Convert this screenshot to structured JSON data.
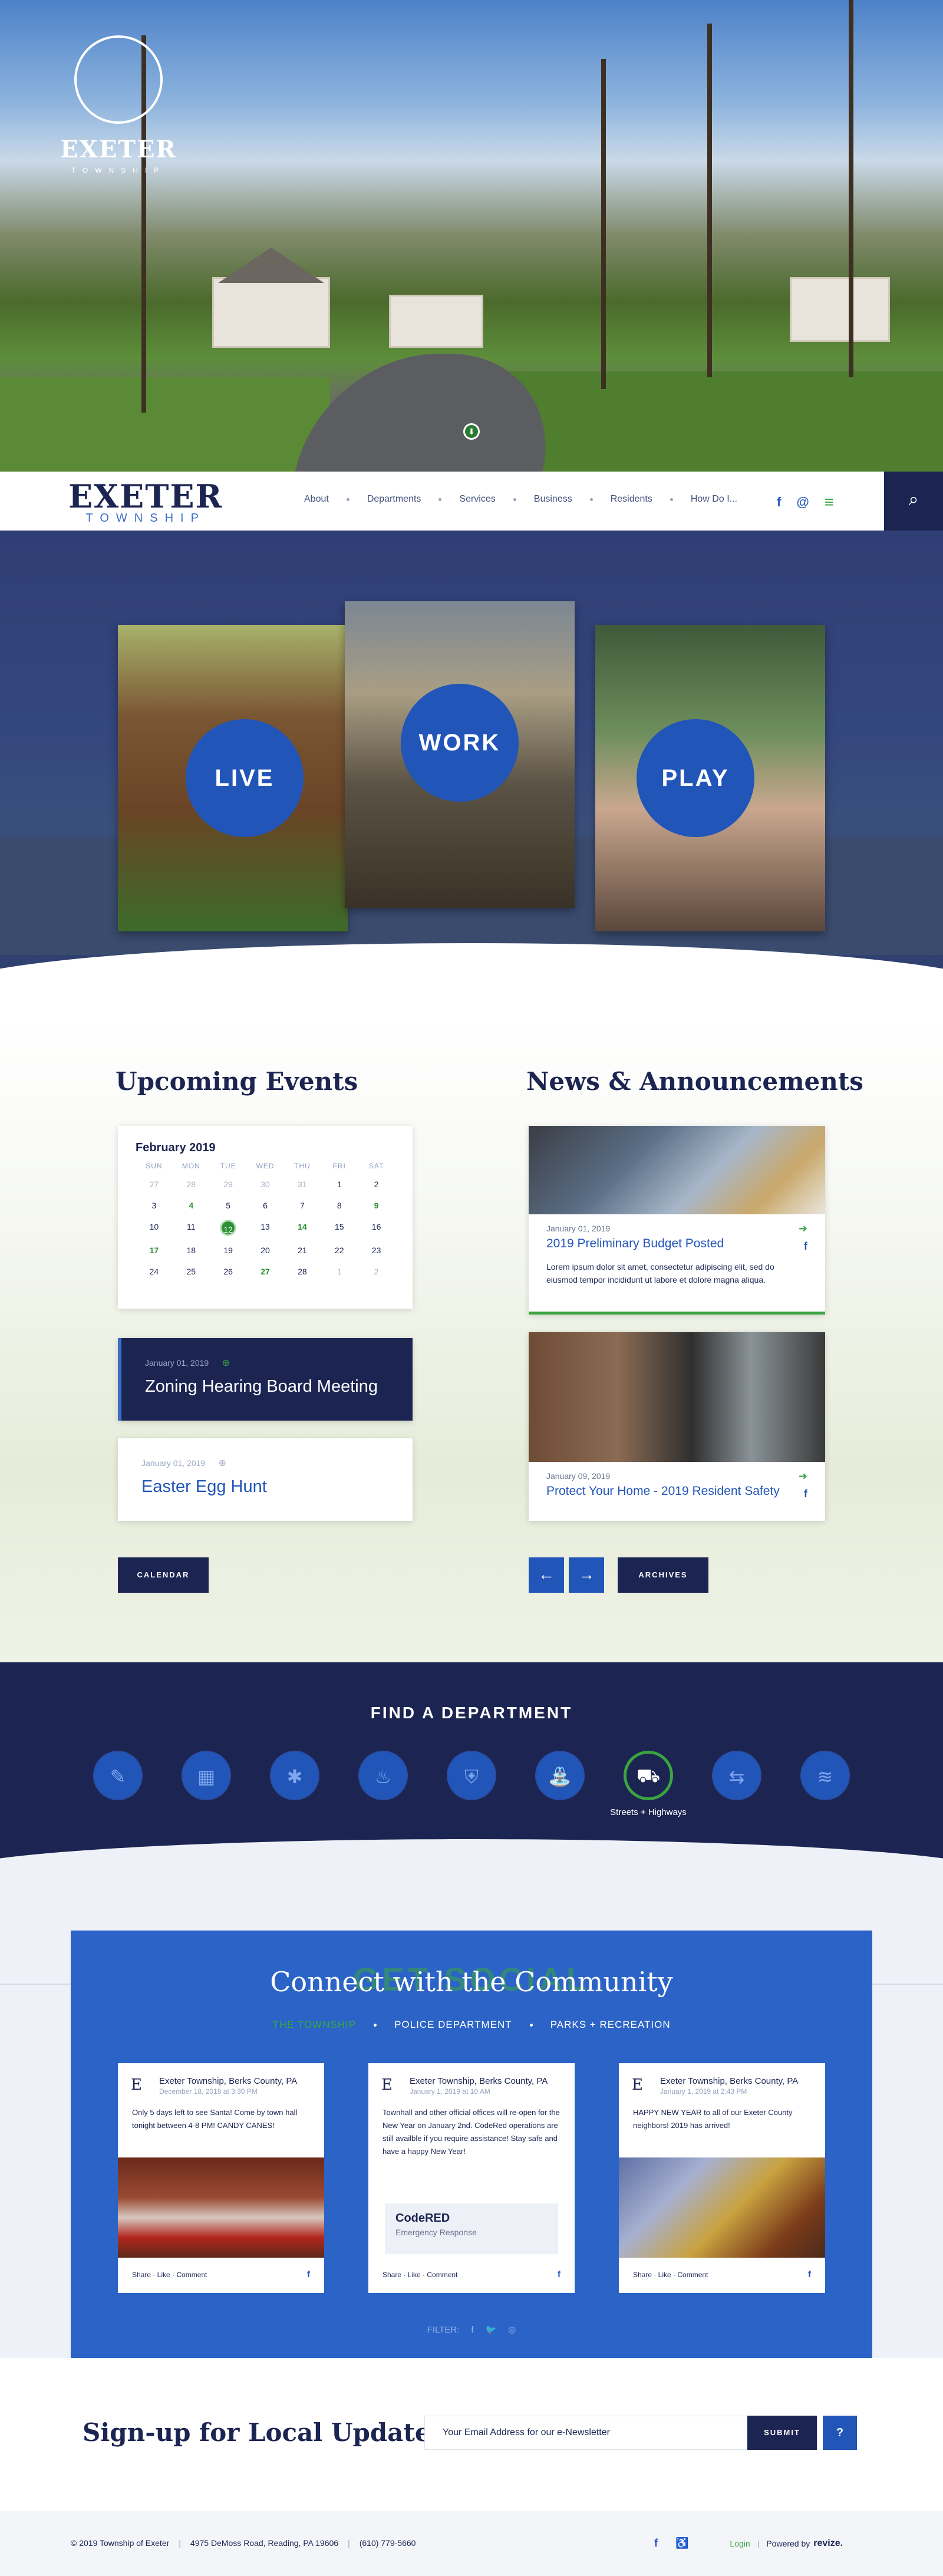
{
  "hero": {
    "logo_name": "EXETER",
    "logo_sub": "TOWNSHIP",
    "scroll_icon": "arrow-down-icon",
    "scroll_glyph": "⬇"
  },
  "nav": {
    "logo_name": "EXETER",
    "logo_sub": "TOWNSHIP",
    "links": [
      "About",
      "Departments",
      "Services",
      "Business",
      "Residents",
      "How Do I..."
    ],
    "social": {
      "facebook": "f",
      "email": "@",
      "menu": "≡"
    },
    "search_glyph": "⌕"
  },
  "lwp": {
    "live": "LIVE",
    "work": "WORK",
    "play": "PLAY"
  },
  "events": {
    "title": "Upcoming Events",
    "calendar": {
      "month": "February 2019",
      "dow": [
        "SUN",
        "MON",
        "TUE",
        "WED",
        "THU",
        "FRI",
        "SAT"
      ],
      "days": [
        [
          "27",
          "28",
          "29",
          "30",
          "31",
          "1",
          "2"
        ],
        [
          "3",
          "4",
          "5",
          "6",
          "7",
          "8",
          "9"
        ],
        [
          "10",
          "11",
          "12",
          "13",
          "14",
          "15",
          "16"
        ],
        [
          "17",
          "18",
          "19",
          "20",
          "21",
          "22",
          "23"
        ],
        [
          "24",
          "25",
          "26",
          "27",
          "28",
          "1",
          "2"
        ]
      ]
    },
    "items": [
      {
        "date": "January 01, 2019",
        "title": "Zoning Hearing Board Meeting",
        "icon": "⊕"
      },
      {
        "date": "January 01, 2019",
        "title": "Easter Egg Hunt",
        "icon": "⊕"
      }
    ],
    "button": "CALENDAR"
  },
  "news": {
    "title": "News & Announcements",
    "items": [
      {
        "date": "January 01, 2019",
        "title": "2019 Preliminary Budget Posted",
        "text": "Lorem ipsum dolor sit amet, consectetur adipiscing elit, sed do eiusmod tempor incididunt ut labore et dolore magna aliqua."
      },
      {
        "date": "January 09, 2019",
        "title": "Protect Your Home - 2019 Resident Safety"
      }
    ],
    "arrow": "➜",
    "fb": "f",
    "prev": "←",
    "next": "→",
    "archives": "ARCHIVES"
  },
  "dept": {
    "title": "FIND A DEPARTMENT",
    "items": [
      {
        "icon": "✎",
        "name": "document-icon"
      },
      {
        "icon": "▦",
        "name": "brick-icon"
      },
      {
        "icon": "✱",
        "name": "medical-icon"
      },
      {
        "icon": "♨",
        "name": "fire-icon"
      },
      {
        "icon": "⛨",
        "name": "police-icon"
      },
      {
        "icon": "⛲",
        "name": "water-icon"
      },
      {
        "icon": "⛟",
        "name": "bus-icon"
      },
      {
        "icon": "⇆",
        "name": "signpost-icon"
      },
      {
        "icon": "≋",
        "name": "waves-icon"
      }
    ],
    "active_label": "Streets + Highways"
  },
  "social": {
    "ghost": "GET SOCIAL",
    "title": "Connect with the Community",
    "tabs": [
      "THE TOWNSHIP",
      "POLICE DEPARTMENT",
      "PARKS + RECREATION"
    ],
    "posts": [
      {
        "name": "Exeter Township, Berks County, PA",
        "date": "December 18, 2018 at 3:30 PM",
        "text": "Only 5 days left to see Santa! Come by town hall tonight between 4-8 PM! CANDY CANES!",
        "foot": "Share · Like · Comment"
      },
      {
        "name": "Exeter Township, Berks County, PA",
        "date": "January 1, 2019 at 10 AM",
        "text": "Townhall and other official offices will re-open for the New Year on January 2nd. CodeRed operations are still availble if you require assistance! Stay safe and have a happy New Year!",
        "box_title": "CodeRED",
        "box_sub": "Emergency Response",
        "foot": "Share · Like · Comment"
      },
      {
        "name": "Exeter Township, Berks County, PA",
        "date": "January 1, 2019 at 2:43 PM",
        "text": "HAPPY NEW YEAR to all of our Exeter County neighbors! 2019 has arrived!",
        "foot": "Share · Like · Comment"
      }
    ],
    "logo_letter": "E",
    "fb": "f",
    "filter_label": "FILTER:",
    "filter_icons": [
      "f",
      "🐦",
      "◎"
    ]
  },
  "signup": {
    "title": "Sign-up for Local Updates:",
    "placeholder": "Your Email Address for our e-Newsletter",
    "button": "SUBMIT",
    "help": "?"
  },
  "footer": {
    "copyright": "© 2019 Township of Exeter",
    "address": "4975 DeMoss Road, Reading, PA 19606",
    "phone": "(610) 779-5660",
    "fb": "f",
    "accessibility": "♿",
    "login": "Login",
    "powered": "Powered by",
    "brand": "revize."
  },
  "colors": {
    "navy": "#1c2552",
    "blue": "#2155b8",
    "green": "#3aa540"
  }
}
